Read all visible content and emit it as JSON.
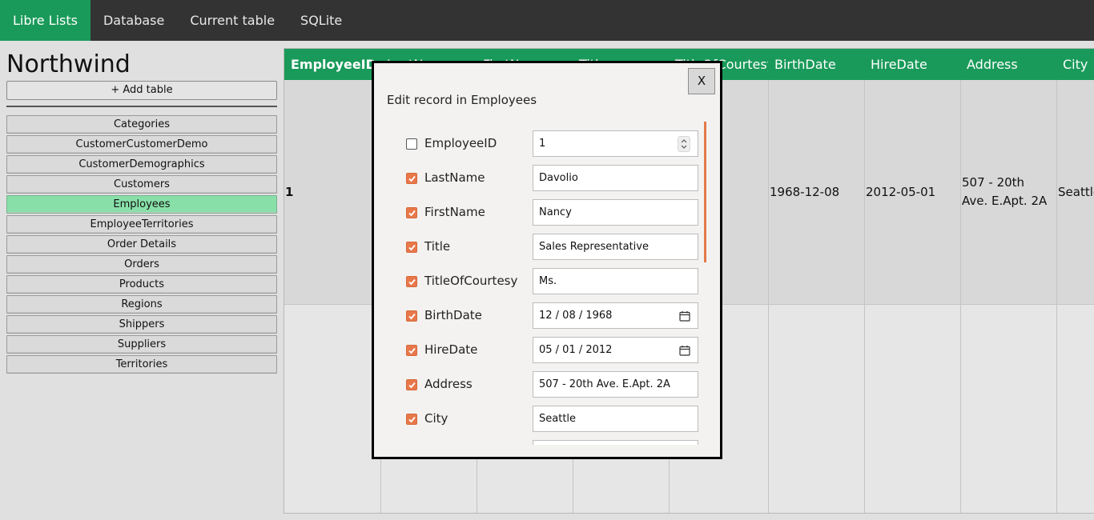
{
  "nav": {
    "items": [
      "Libre Lists",
      "Database",
      "Current table",
      "SQLite"
    ],
    "active_index": 0
  },
  "sidebar": {
    "db_name": "Northwind",
    "add_table_label": "+ Add table",
    "tables": [
      "Categories",
      "CustomerCustomerDemo",
      "CustomerDemographics",
      "Customers",
      "Employees",
      "EmployeeTerritories",
      "Order Details",
      "Orders",
      "Products",
      "Regions",
      "Shippers",
      "Suppliers",
      "Territories"
    ],
    "active_table": "Employees"
  },
  "grid": {
    "columns": [
      "EmployeeID",
      "LastName",
      "FirstName",
      "Title",
      "TitleOfCourtesy",
      "BirthDate",
      "HireDate",
      "Address",
      "City"
    ],
    "rows": [
      {
        "EmployeeID": "1",
        "BirthDate": "1968-12-08",
        "HireDate": "2012-05-01",
        "Address": "507 - 20th Ave. E.Apt. 2A",
        "City": "Seattle"
      }
    ]
  },
  "modal": {
    "title": "Edit record in Employees",
    "close_label": "X",
    "fields": [
      {
        "name": "EmployeeID",
        "checked": false,
        "value": "1",
        "kind": "number"
      },
      {
        "name": "LastName",
        "checked": true,
        "value": "Davolio",
        "kind": "text"
      },
      {
        "name": "FirstName",
        "checked": true,
        "value": "Nancy",
        "kind": "text"
      },
      {
        "name": "Title",
        "checked": true,
        "value": "Sales Representative",
        "kind": "text"
      },
      {
        "name": "TitleOfCourtesy",
        "checked": true,
        "value": "Ms.",
        "kind": "text"
      },
      {
        "name": "BirthDate",
        "checked": true,
        "value": "12 / 08 / 1968",
        "kind": "date"
      },
      {
        "name": "HireDate",
        "checked": true,
        "value": "05 / 01 / 2012",
        "kind": "date"
      },
      {
        "name": "Address",
        "checked": true,
        "value": "507 - 20th Ave. E.Apt. 2A",
        "kind": "text"
      },
      {
        "name": "City",
        "checked": true,
        "value": "Seattle",
        "kind": "text"
      }
    ]
  },
  "colors": {
    "accent": "#1a9a5a",
    "active_table": "#88e0a8",
    "checkbox": "#e8774a",
    "nav_bg": "#333333"
  }
}
